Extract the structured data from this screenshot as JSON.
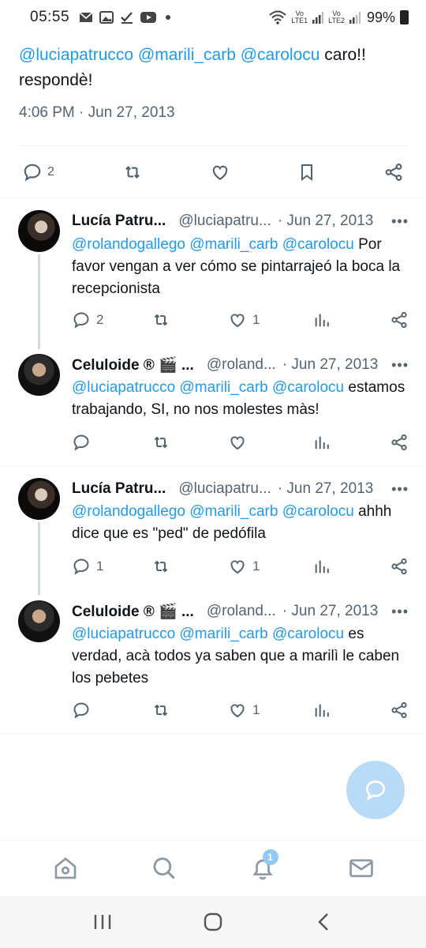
{
  "status_bar": {
    "time": "05:55",
    "battery": "99%",
    "sim1": "Vo\nLTE1",
    "sim2": "Vo\nLTE2"
  },
  "main_tweet": {
    "mentions": "@luciapatrucco @marili_carb @carolocu",
    "text_rest": " caro!! respondè!",
    "timestamp": "4:06 PM · Jun 27, 2013",
    "reply_count": "2"
  },
  "replies": [
    {
      "name": "Lucía Patru...",
      "handle": "@luciapatru...",
      "date": "· Jun 27, 2013",
      "mentions": "@rolandogallego @marili_carb @carolocu",
      "text": " Por favor vengan a ver cómo se pintarrajeó la boca la recepcionista",
      "reply_count": "2",
      "retweet_count": "",
      "like_count": "1"
    },
    {
      "name": "Celuloide ® 🎬 ...",
      "handle": "@roland...",
      "date": "· Jun 27, 2013",
      "mentions": "@luciapatrucco @marili_carb @carolocu",
      "text": " estamos trabajando, SI, no nos molestes màs!",
      "reply_count": "",
      "retweet_count": "",
      "like_count": ""
    },
    {
      "name": "Lucía Patru...",
      "handle": "@luciapatru...",
      "date": "· Jun 27, 2013",
      "mentions": "@rolandogallego @marili_carb @carolocu",
      "text": " ahhh dice que es \"ped\" de pedófila",
      "reply_count": "1",
      "retweet_count": "",
      "like_count": "1"
    },
    {
      "name": "Celuloide ® 🎬 ...",
      "handle": "@roland...",
      "date": "· Jun 27, 2013",
      "mentions": "@luciapatrucco @marili_carb @carolocu",
      "text": " es verdad, acà todos ya saben que a marilì le caben los pebetes",
      "reply_count": "",
      "retweet_count": "",
      "like_count": "1"
    }
  ],
  "more_label": "•••",
  "bottom_nav": {
    "notifications_badge": "1"
  },
  "colors": {
    "accent": "#1d9bf0",
    "secondary_text": "#536471",
    "fab": "#b8dcf7"
  }
}
